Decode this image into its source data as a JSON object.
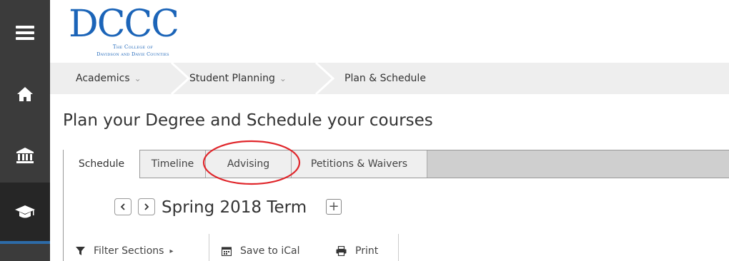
{
  "logo": {
    "main": "DCCC",
    "line1": "The College of",
    "line2": "Davidson and Davie Counties"
  },
  "breadcrumb": [
    {
      "label": "Academics",
      "has_dropdown": true
    },
    {
      "label": "Student Planning",
      "has_dropdown": true
    },
    {
      "label": "Plan & Schedule",
      "has_dropdown": false
    }
  ],
  "page_title": "Plan your Degree and Schedule your courses",
  "tabs": [
    {
      "label": "Schedule",
      "active": true
    },
    {
      "label": "Timeline",
      "active": false
    },
    {
      "label": "Advising",
      "active": false
    },
    {
      "label": "Petitions & Waivers",
      "active": false
    }
  ],
  "term": {
    "title": "Spring 2018 Term",
    "add_symbol": "+"
  },
  "toolbar": {
    "filter_label": "Filter Sections",
    "filter_chevron": "▸",
    "ical_label": "Save to iCal",
    "print_label": "Print"
  },
  "nav_rail": {
    "icons": [
      "menu-icon",
      "home-icon",
      "bank-icon",
      "graduation-cap-icon"
    ]
  },
  "colors": {
    "rail": "#3b3b3b",
    "rail_active": "#262626",
    "accent": "#2d6ba8",
    "logo": "#1b64b8",
    "annotation": "#e0262b"
  }
}
